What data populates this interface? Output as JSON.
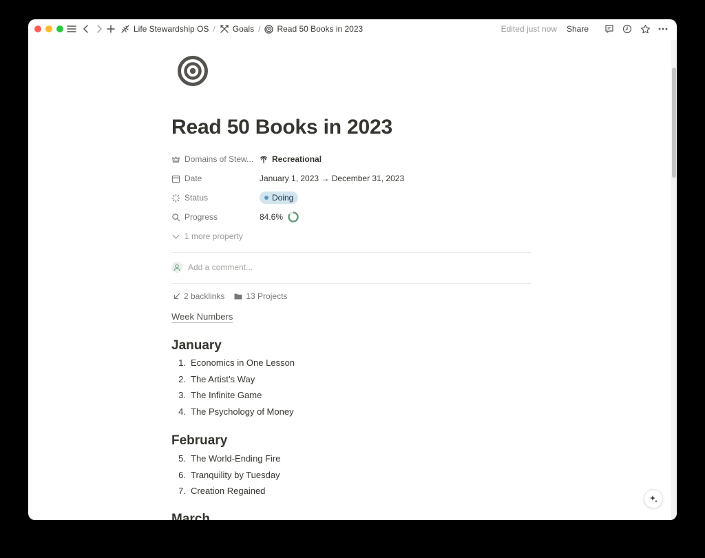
{
  "topbar": {
    "breadcrumbs": [
      {
        "label": "Life Stewardship OS",
        "icon": "quill-icon"
      },
      {
        "label": "Goals",
        "icon": "arrows-icon"
      },
      {
        "label": "Read 50 Books in 2023",
        "icon": "target-icon"
      }
    ],
    "separator": "/",
    "edited": "Edited just now",
    "share": "Share"
  },
  "page": {
    "icon": "target-icon",
    "title": "Read 50 Books in 2023"
  },
  "properties": {
    "domains": {
      "label": "Domains of Stew...",
      "value": "Recreational"
    },
    "date": {
      "label": "Date",
      "value": "January 1, 2023 → December 31, 2023"
    },
    "status": {
      "label": "Status",
      "value": "Doing",
      "color": "#d3e5ef"
    },
    "progress": {
      "label": "Progress",
      "value": "84.6%",
      "fraction": 0.846
    },
    "more": "1 more property"
  },
  "comment": {
    "placeholder": "Add a comment..."
  },
  "links": {
    "backlinks": "2 backlinks",
    "projects": "13 Projects"
  },
  "body": {
    "week_numbers": "Week Numbers",
    "sections": [
      {
        "month": "January",
        "items": [
          {
            "n": "1.",
            "title": "Economics in One Lesson"
          },
          {
            "n": "2.",
            "title": "The Artist’s Way"
          },
          {
            "n": "3.",
            "title": "The Infinite Game"
          },
          {
            "n": "4.",
            "title": "The Psychology of Money"
          }
        ]
      },
      {
        "month": "February",
        "items": [
          {
            "n": "5.",
            "title": "The World-Ending Fire"
          },
          {
            "n": "6.",
            "title": "Tranquility by Tuesday"
          },
          {
            "n": "7.",
            "title": "Creation Regained"
          }
        ]
      },
      {
        "month": "March",
        "items": []
      }
    ]
  }
}
